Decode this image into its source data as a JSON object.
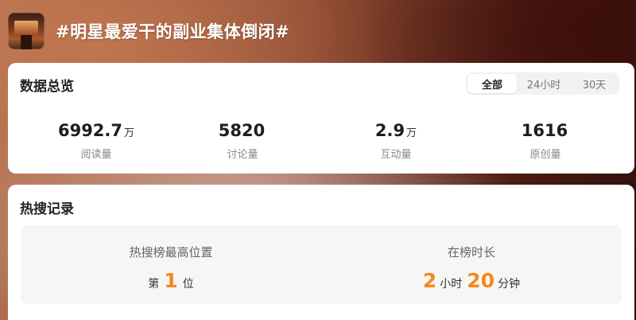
{
  "header": {
    "title": "#明星最爱干的副业集体倒闭#"
  },
  "overview": {
    "title": "数据总览",
    "tabs": [
      {
        "label": "全部",
        "active": true
      },
      {
        "label": "24小时",
        "active": false
      },
      {
        "label": "30天",
        "active": false
      }
    ],
    "stats": [
      {
        "value": "6992.7",
        "unit": "万",
        "label": "阅读量"
      },
      {
        "value": "5820",
        "unit": "",
        "label": "讨论量"
      },
      {
        "value": "2.9",
        "unit": "万",
        "label": "互动量"
      },
      {
        "value": "1616",
        "unit": "",
        "label": "原创量"
      }
    ]
  },
  "record": {
    "title": "热搜记录",
    "highest": {
      "label": "热搜榜最高位置",
      "prefix": "第",
      "value": "1",
      "suffix": "位"
    },
    "duration": {
      "label": "在榜时长",
      "hours": "2",
      "hours_unit": "小时",
      "minutes": "20",
      "minutes_unit": "分钟"
    }
  },
  "colors": {
    "accent": "#f08a1c"
  }
}
